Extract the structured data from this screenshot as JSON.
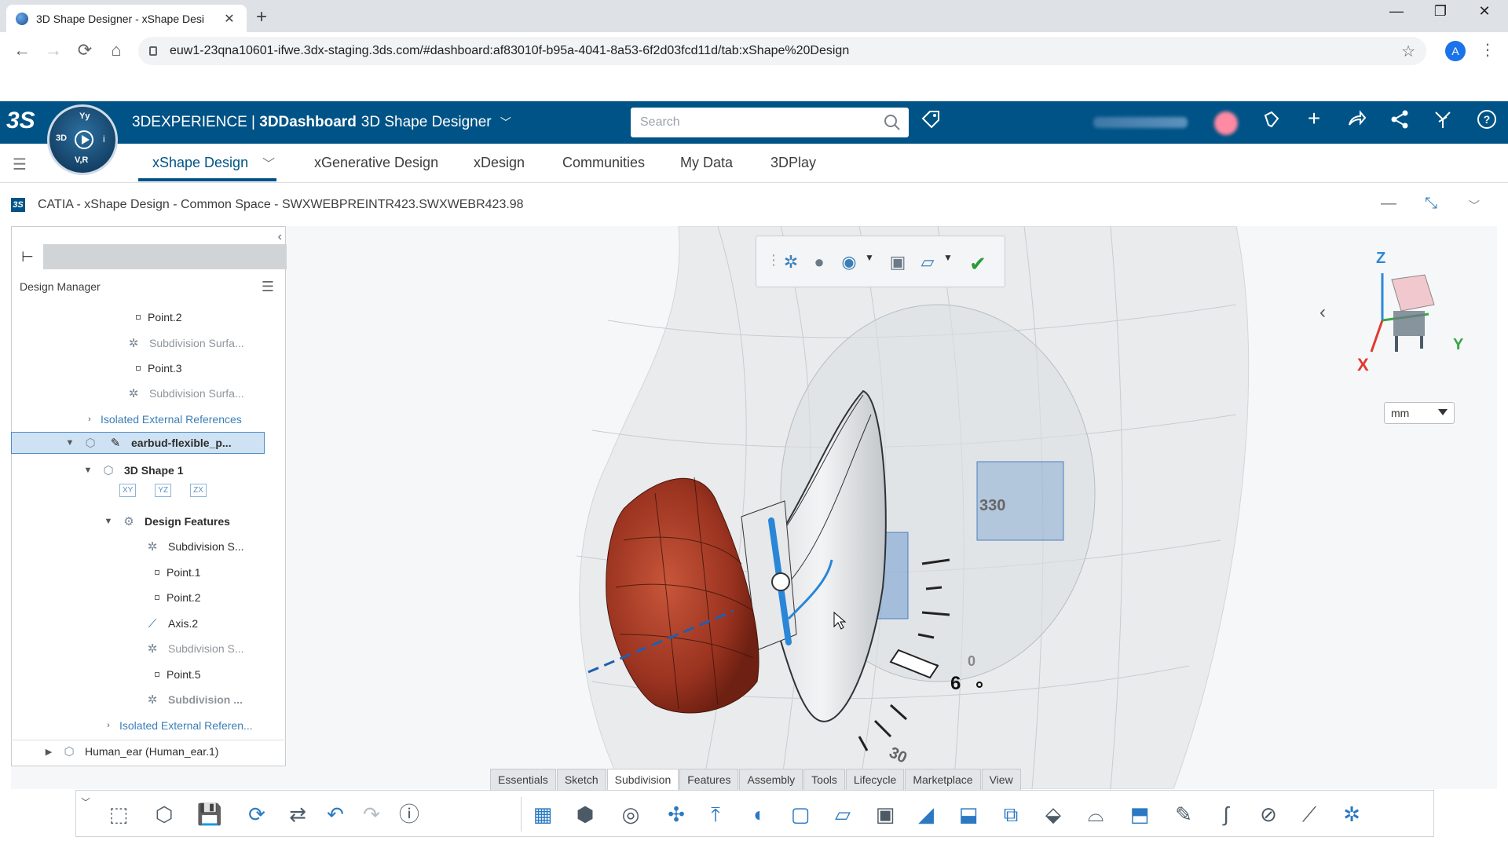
{
  "browser": {
    "tab_title": "3D Shape Designer - xShape Desi",
    "tab_close": "✕",
    "new_tab": "+",
    "url": "euw1-23qna10601-ifwe.3dx-staging.3ds.com/#dashboard:af83010f-b95a-4041-8a53-6f2d03fcd11d/tab:xShape%20Design",
    "profile_initial": "A",
    "window_controls": [
      "—",
      "❐",
      "✕"
    ],
    "nav_icons": [
      "←",
      "→",
      "⟳",
      "⌂"
    ]
  },
  "topbar": {
    "brand_a": "3DEXPERIENCE | ",
    "brand_b": "3DDashboard",
    "brand_c": "3D Shape Designer",
    "search_placeholder": "Search",
    "compass": {
      "top": "Yy",
      "left": "3D",
      "bottom": "V,R",
      "right": "i"
    },
    "icons": [
      "tag-icon",
      "notification-icon",
      "add-icon",
      "share-icon",
      "network-icon",
      "compass-tool-icon",
      "help-icon"
    ]
  },
  "app_tabs": [
    "xShape Design",
    "xGenerative Design",
    "xDesign",
    "Communities",
    "My Data",
    "3DPlay"
  ],
  "widget": {
    "title": "CATIA - xShape Design - Common Space - SWXWEBPREINTR423.SWXWEBR423.98"
  },
  "tree": {
    "title": "Design Manager",
    "rows": [
      {
        "label": "Point.2",
        "style": "normal"
      },
      {
        "label": "Subdivision Surfa...",
        "style": "dim"
      },
      {
        "label": "Point.3",
        "style": "normal"
      },
      {
        "label": "Subdivision Surfa...",
        "style": "dim"
      },
      {
        "label": "Isolated External References",
        "style": "link"
      },
      {
        "label": "earbud-flexible_p...",
        "style": "bold"
      },
      {
        "label": "3D Shape 1",
        "style": "bold"
      },
      {
        "label": "Design Features",
        "style": "bold"
      },
      {
        "label": "Subdivision S...",
        "style": "normal"
      },
      {
        "label": "Point.1",
        "style": "normal"
      },
      {
        "label": "Point.2",
        "style": "normal"
      },
      {
        "label": "Axis.2",
        "style": "normal"
      },
      {
        "label": "Subdivision S...",
        "style": "dim"
      },
      {
        "label": "Point.5",
        "style": "normal"
      },
      {
        "label": "Subdivision ...",
        "style": "dimbold"
      },
      {
        "label": "Isolated External Referen...",
        "style": "link"
      },
      {
        "label": "Human_ear (Human_ear.1)",
        "style": "normal"
      }
    ],
    "planes": [
      "XY",
      "YZ",
      "ZX"
    ]
  },
  "viewport": {
    "dial_labels": [
      "330",
      "0",
      "6",
      "30"
    ],
    "axes": {
      "z": "Z",
      "x": "X",
      "y": "Y"
    },
    "unit": "mm"
  },
  "ribbon_tabs": [
    "Essentials",
    "Sketch",
    "Subdivision",
    "Features",
    "Assembly",
    "Tools",
    "Lifecycle",
    "Marketplace",
    "View"
  ],
  "ribbon_active": "Subdivision",
  "colors": {
    "topbar": "#005386",
    "earbud_tip": "#a23a22",
    "accent": "#2a86d6"
  }
}
